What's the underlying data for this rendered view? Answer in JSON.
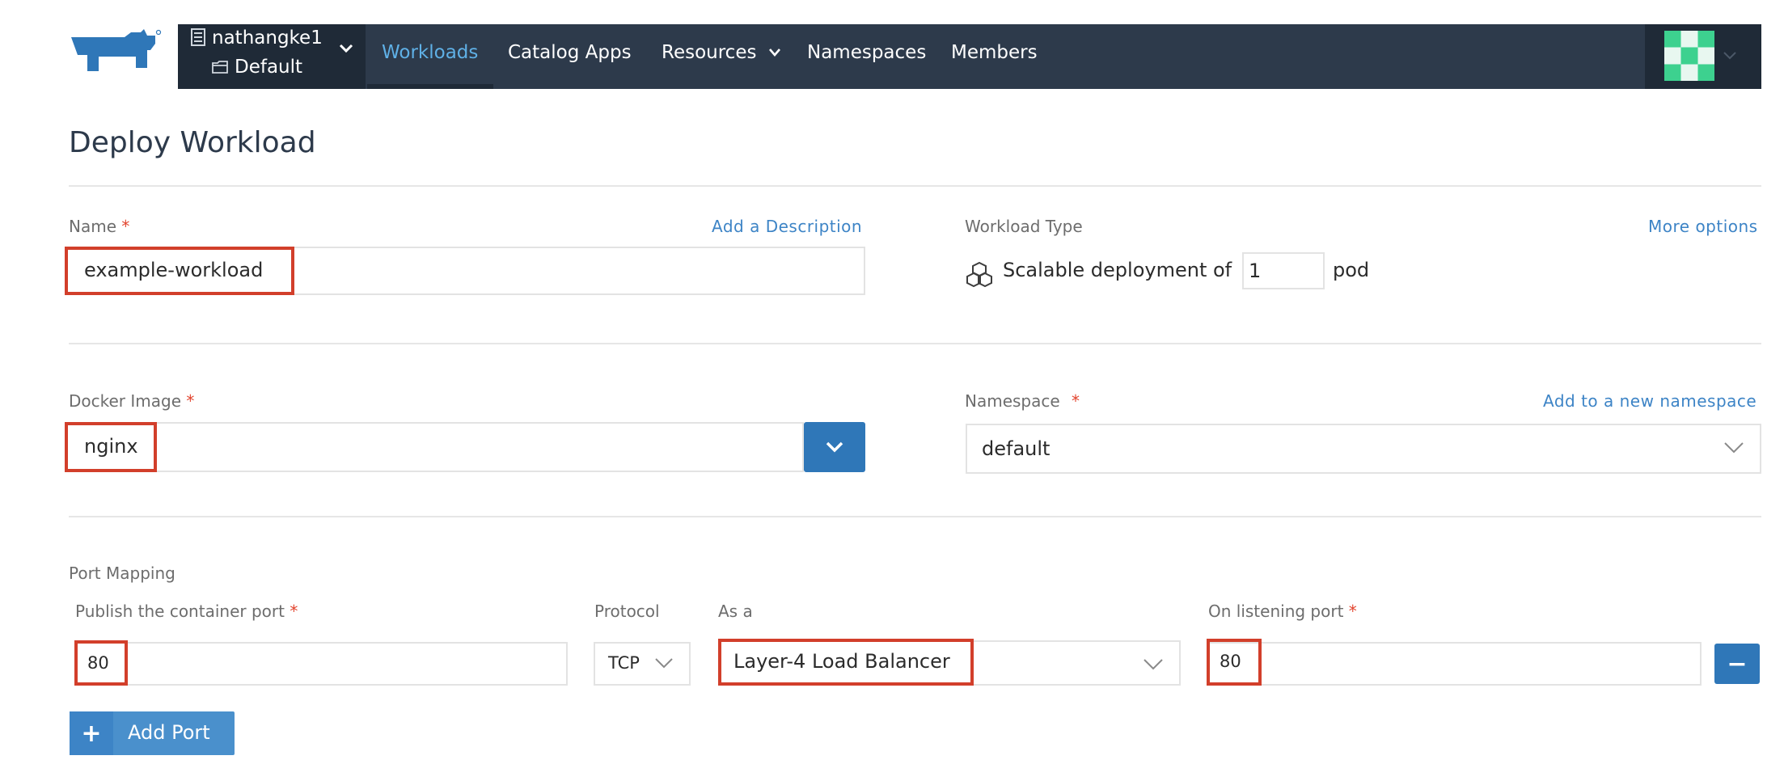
{
  "nav": {
    "cluster": "nathangke1",
    "project": "Default",
    "items": [
      {
        "label": "Workloads",
        "active": true
      },
      {
        "label": "Catalog Apps"
      },
      {
        "label": "Resources"
      },
      {
        "label": "Namespaces"
      },
      {
        "label": "Members"
      }
    ],
    "colors": {
      "bar": "#2d3a4b",
      "active": "#5fb0e6"
    }
  },
  "page": {
    "title": "Deploy Workload"
  },
  "form": {
    "name": {
      "label": "Name",
      "required": "*",
      "value": "example-workload",
      "add_description_link": "Add a Description"
    },
    "workload_type": {
      "label": "Workload Type",
      "more_options_link": "More options",
      "prefix": "Scalable deployment of",
      "pods": "1",
      "suffix": "pod"
    },
    "docker_image": {
      "label": "Docker Image",
      "required": "*",
      "value": "nginx"
    },
    "namespace": {
      "label": "Namespace",
      "required": "*",
      "add_link": "Add to a new namespace",
      "value": "default"
    },
    "port_mapping": {
      "label": "Port Mapping",
      "container_port_label": "Publish the container port",
      "required": "*",
      "protocol_label": "Protocol",
      "as_label": "As a",
      "listening_port_label": "On listening port",
      "rows": [
        {
          "container_port": "80",
          "protocol": "TCP",
          "as": "Layer-4 Load Balancer",
          "listening_port": "80"
        }
      ],
      "remove_button": "−",
      "add_button_icon": "+",
      "add_button_label": "Add Port"
    }
  },
  "annotation_color": "#d23f2b"
}
